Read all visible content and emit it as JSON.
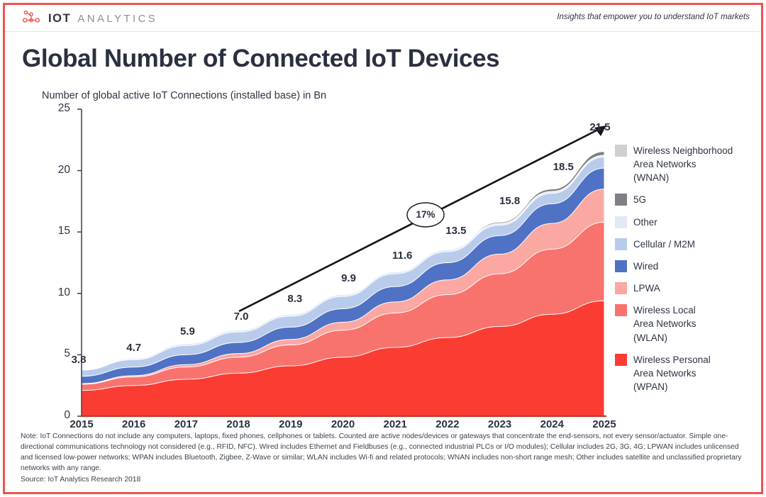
{
  "header": {
    "logo_iot": "IOT",
    "logo_analytics": "ANALYTICS",
    "logo_icon": "network-nodes-icon",
    "tagline": "Insights that empower you to understand IoT markets"
  },
  "title": "Global Number of Connected IoT Devices",
  "subtitle": "Number of global active IoT Connections (installed base) in Bn",
  "colors": {
    "brand_red": "#f0534d",
    "title_navy": "#2b3040",
    "wpan": "#fa3c32",
    "wlan": "#f9736e",
    "lpwa": "#fba7a2",
    "wired": "#4f72c4",
    "cellular": "#b9cbeb",
    "other": "#e2e9f5",
    "fiveg": "#7f8084",
    "wnan": "#cfd0d2"
  },
  "footnote": {
    "note": "Note: IoT Connections do not include any computers, laptops, fixed phones, cellphones or tablets. Counted are active nodes/devices or gateways that concentrate the end-sensors, not every sensor/actuator. Simple one-directional communications technology not considered (e.g., RFID, NFC). Wired includes Ethernet and Fieldbuses (e.g., connected industrial PLCs or I/O modules); Cellular includes 2G, 3G, 4G;  LPWAN includes unlicensed and licensed low-power networks; WPAN includes Bluetooth, Zigbee, Z-Wave or similar; WLAN includes Wi-fi and related protocols; WNAN includes non-short range mesh; Other includes satellite and unclassified proprietary networks with any range.",
    "source": "Source: IoT Analytics Research 2018"
  },
  "chart_data": {
    "type": "area",
    "stacked": true,
    "title": "Global Number of Connected IoT Devices",
    "subtitle": "Number of global active IoT Connections (installed base) in Bn",
    "xlabel": "",
    "ylabel": "Number of global active IoT Connections (installed base) in Bn",
    "ylim": [
      0,
      25
    ],
    "yticks": [
      0,
      5,
      10,
      15,
      20,
      25
    ],
    "ytick_labels": [
      "0",
      "5",
      "10",
      "15",
      "20",
      "25"
    ],
    "grid": false,
    "legend_position": "right",
    "categories": [
      2015,
      2016,
      2017,
      2018,
      2019,
      2020,
      2021,
      2022,
      2023,
      2024,
      2025
    ],
    "xtick_labels": [
      "2015",
      "2016",
      "2017",
      "2018",
      "2019",
      "2020",
      "2021",
      "2022",
      "2023",
      "2024",
      "2025"
    ],
    "totals": [
      3.8,
      4.7,
      5.9,
      7.0,
      8.3,
      9.9,
      11.6,
      13.5,
      15.8,
      18.5,
      21.5
    ],
    "total_labels": [
      "3.8",
      "4.7",
      "5.9",
      "7.0",
      "8.3",
      "9.9",
      "11.6",
      "13.5",
      "15.8",
      "18.5",
      "21.5"
    ],
    "series": [
      {
        "name": "Wireless Personal Area Networks (WPAN)",
        "short": "WPAN",
        "color": "#fa3c32",
        "values": [
          2.1,
          2.5,
          3.0,
          3.5,
          4.1,
          4.8,
          5.6,
          6.4,
          7.3,
          8.3,
          9.4
        ]
      },
      {
        "name": "Wireless Local Area Networks (WLAN)",
        "short": "WLAN",
        "color": "#f9736e",
        "values": [
          0.5,
          0.7,
          1.0,
          1.3,
          1.7,
          2.2,
          2.8,
          3.5,
          4.3,
          5.3,
          6.4
        ]
      },
      {
        "name": "LPWA",
        "short": "LPWA",
        "color": "#fba7a2",
        "values": [
          0.05,
          0.1,
          0.2,
          0.3,
          0.45,
          0.65,
          0.9,
          1.2,
          1.6,
          2.1,
          2.7
        ]
      },
      {
        "name": "Wired",
        "short": "Wired",
        "color": "#4f72c4",
        "values": [
          0.6,
          0.7,
          0.8,
          0.9,
          1.0,
          1.1,
          1.25,
          1.4,
          1.5,
          1.6,
          1.7
        ]
      },
      {
        "name": "Cellular / M2M",
        "short": "Cellular / M2M",
        "color": "#b9cbeb",
        "values": [
          0.5,
          0.6,
          0.75,
          0.85,
          0.9,
          1.0,
          1.05,
          0.9,
          0.85,
          0.85,
          0.9
        ]
      },
      {
        "name": "Other",
        "short": "Other",
        "color": "#e2e9f5",
        "values": [
          0.05,
          0.1,
          0.15,
          0.15,
          0.15,
          0.15,
          0.15,
          0.15,
          0.15,
          0.15,
          0.15
        ]
      },
      {
        "name": "5G",
        "short": "5G",
        "color": "#7f8084",
        "values": [
          0,
          0,
          0,
          0,
          0,
          0,
          0.0,
          0.05,
          0.1,
          0.2,
          0.3
        ]
      },
      {
        "name": "Wireless Neighborhood Area Networks (WNAN)",
        "short": "WNAN",
        "color": "#cfd0d2",
        "values": [
          0,
          0,
          0,
          0.0,
          0.0,
          0.0,
          0.0,
          0.0,
          0.02,
          0.04,
          0.05
        ]
      }
    ],
    "annotation": {
      "label": "17%",
      "type": "cagr-arrow",
      "from_year": 2018,
      "to_year": 2025
    }
  },
  "legend": {
    "items": [
      {
        "label": "Wireless Neighborhood\nArea Networks\n(WNAN)",
        "color": "#cfd0d2"
      },
      {
        "label": "5G",
        "color": "#7f8084"
      },
      {
        "label": "Other",
        "color": "#e2e9f5"
      },
      {
        "label": "Cellular / M2M",
        "color": "#b9cbeb"
      },
      {
        "label": "Wired",
        "color": "#4f72c4"
      },
      {
        "label": "LPWA",
        "color": "#fba7a2"
      },
      {
        "label": "Wireless Local\nArea Networks\n(WLAN)",
        "color": "#f9736e"
      },
      {
        "label": "Wireless Personal\nArea Networks\n(WPAN)",
        "color": "#fa3c32"
      }
    ]
  }
}
